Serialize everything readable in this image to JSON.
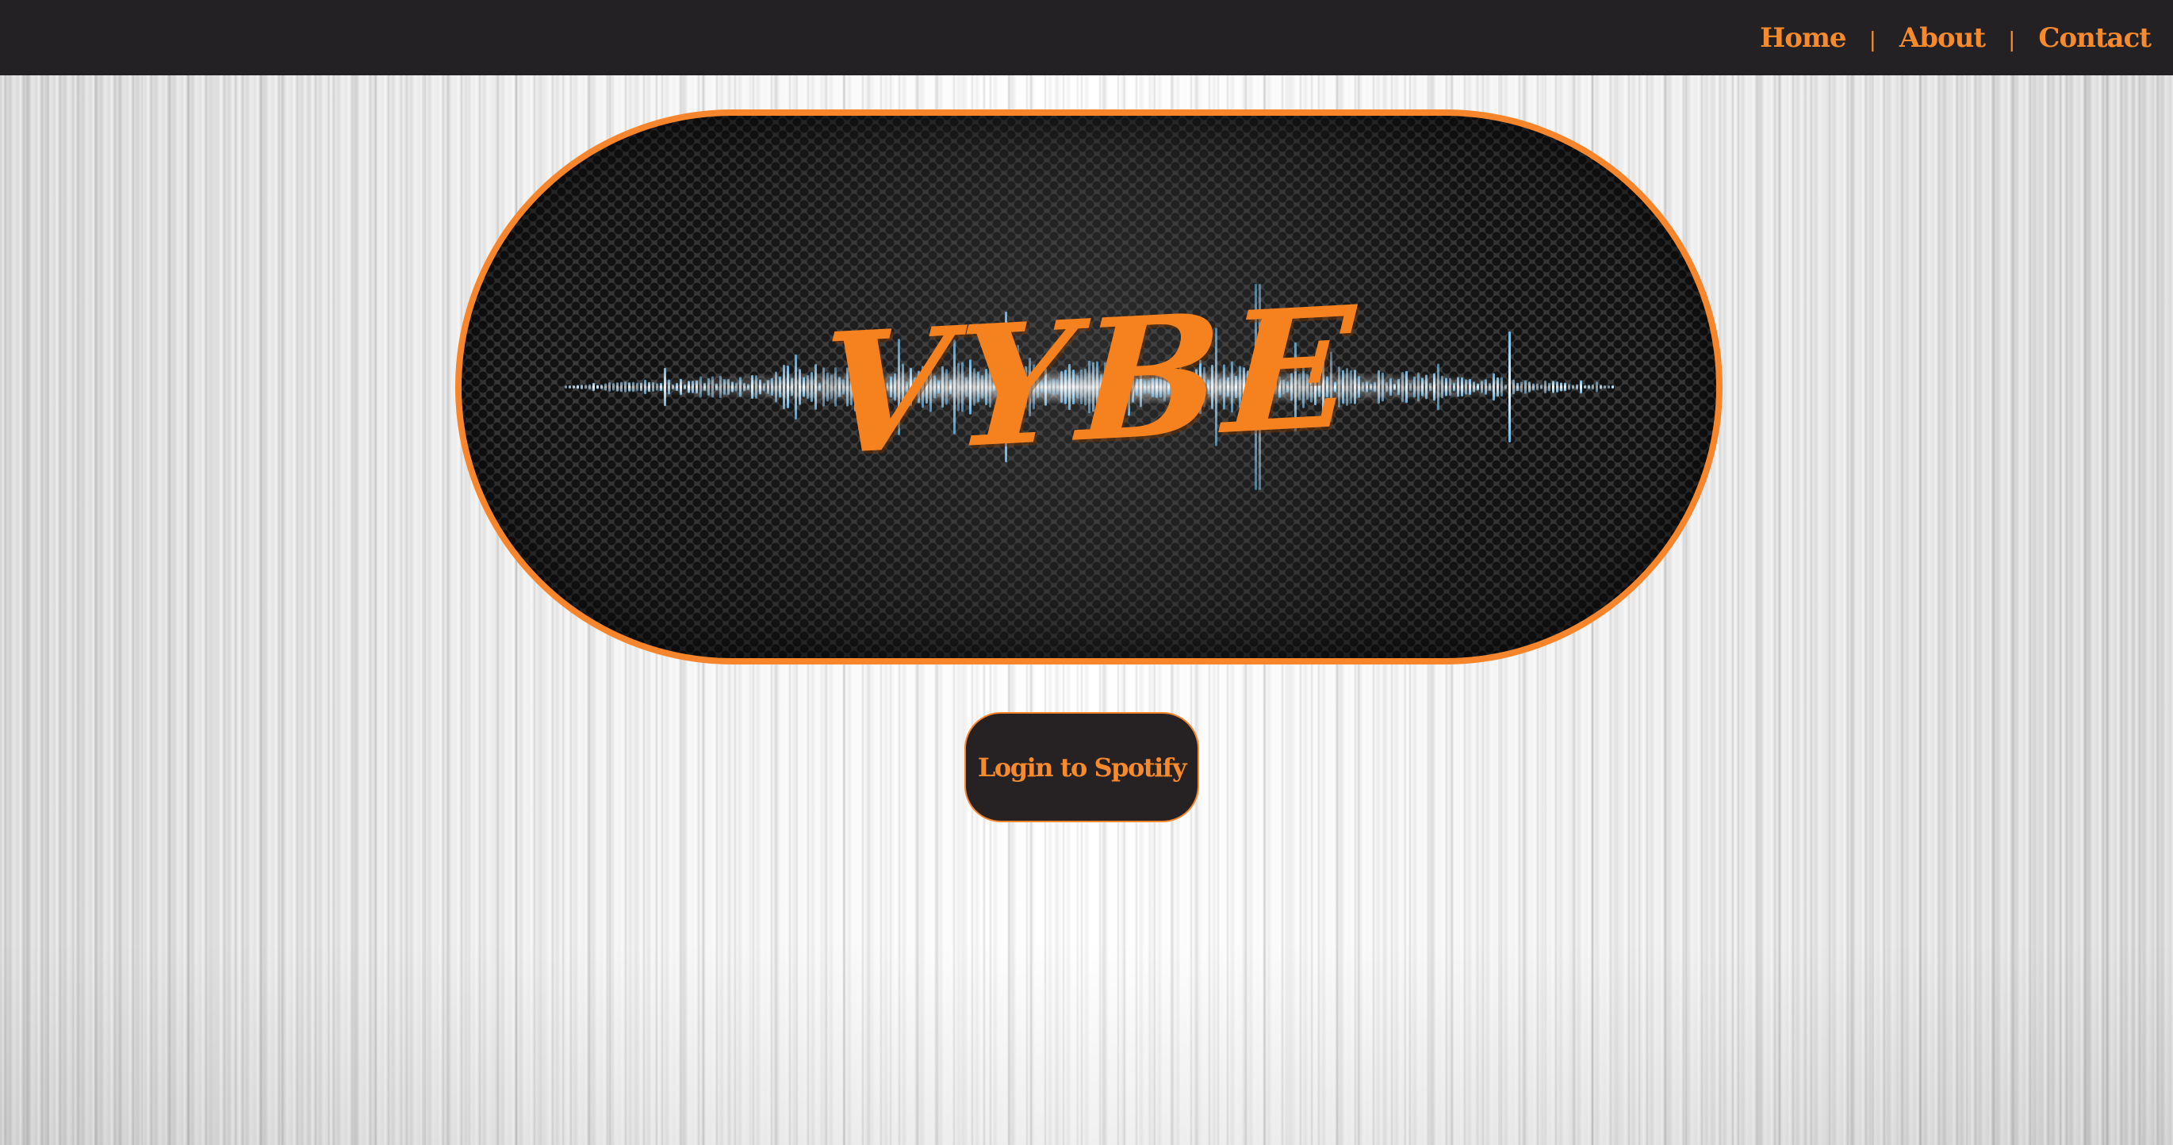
{
  "nav": {
    "items": [
      {
        "label": "Home"
      },
      {
        "label": "About"
      },
      {
        "label": "Contact"
      }
    ],
    "separator": "|"
  },
  "banner": {
    "logo_text": "VYBE"
  },
  "login": {
    "label": "Login to Spotify"
  },
  "colors": {
    "accent": "#f7852b",
    "navbar": "#232123",
    "button_bg": "#262224",
    "wave_blue": "#8fcff0"
  },
  "icons": {
    "banner_graphic": "sound-waveform"
  }
}
